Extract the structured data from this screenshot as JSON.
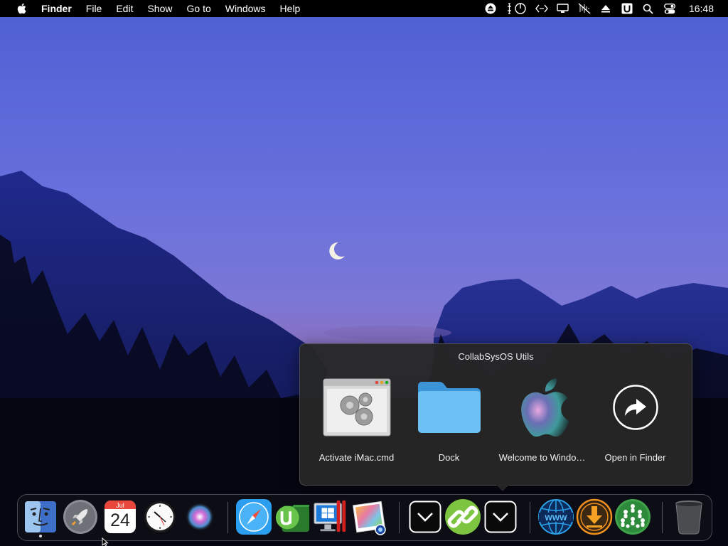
{
  "menubar": {
    "apple_icon": "apple-logo-icon",
    "app_name": "Finder",
    "menus": [
      "File",
      "Edit",
      "Show",
      "Go to",
      "Windows",
      "Help"
    ],
    "status_icons": [
      "eject-icon",
      "power-control-icon",
      "code-brackets-icon",
      "display-icon",
      "volume-muted-icon",
      "upload-icon",
      "u-badge-icon",
      "search-icon",
      "control-center-icon"
    ],
    "clock": "16:48"
  },
  "stack_popup": {
    "title": "CollabSysOS Utils",
    "items": [
      {
        "label": "Activate iMac.cmd",
        "icon": "script-gears-icon"
      },
      {
        "label": "Dock",
        "icon": "folder-icon"
      },
      {
        "label": "Welcome to Windo…",
        "icon": "apple-logo-icon"
      },
      {
        "label": "Open in Finder",
        "icon": "share-arrow-icon"
      }
    ]
  },
  "dock": {
    "apps": [
      {
        "name": "finder",
        "icon": "finder-icon",
        "running": true
      },
      {
        "name": "launchpad",
        "icon": "rocket-icon",
        "running": false
      },
      {
        "name": "calendar",
        "icon": "calendar-icon",
        "running": false,
        "month": "Jul",
        "day": "24"
      },
      {
        "name": "clock",
        "icon": "clock-icon",
        "running": false
      },
      {
        "name": "siri",
        "icon": "siri-icon",
        "running": false
      },
      {
        "name": "safari",
        "icon": "compass-icon",
        "running": false
      },
      {
        "name": "utorrent",
        "icon": "utorrent-icon",
        "running": false
      },
      {
        "name": "parallels",
        "icon": "windows-monitor-icon",
        "running": false
      },
      {
        "name": "photo-viewer",
        "icon": "photos-icon",
        "running": false
      },
      {
        "name": "stack-down-1",
        "icon": "chevron-down-icon",
        "running": false
      },
      {
        "name": "link-tool",
        "icon": "link-icon",
        "running": false
      },
      {
        "name": "stack-down-2",
        "icon": "chevron-down-icon",
        "running": false
      },
      {
        "name": "web-globe",
        "icon": "www-globe-icon",
        "running": false
      },
      {
        "name": "downloader",
        "icon": "download-icon",
        "running": false
      },
      {
        "name": "network-users",
        "icon": "users-network-icon",
        "running": false
      },
      {
        "name": "trash",
        "icon": "trash-icon",
        "running": false
      }
    ]
  }
}
